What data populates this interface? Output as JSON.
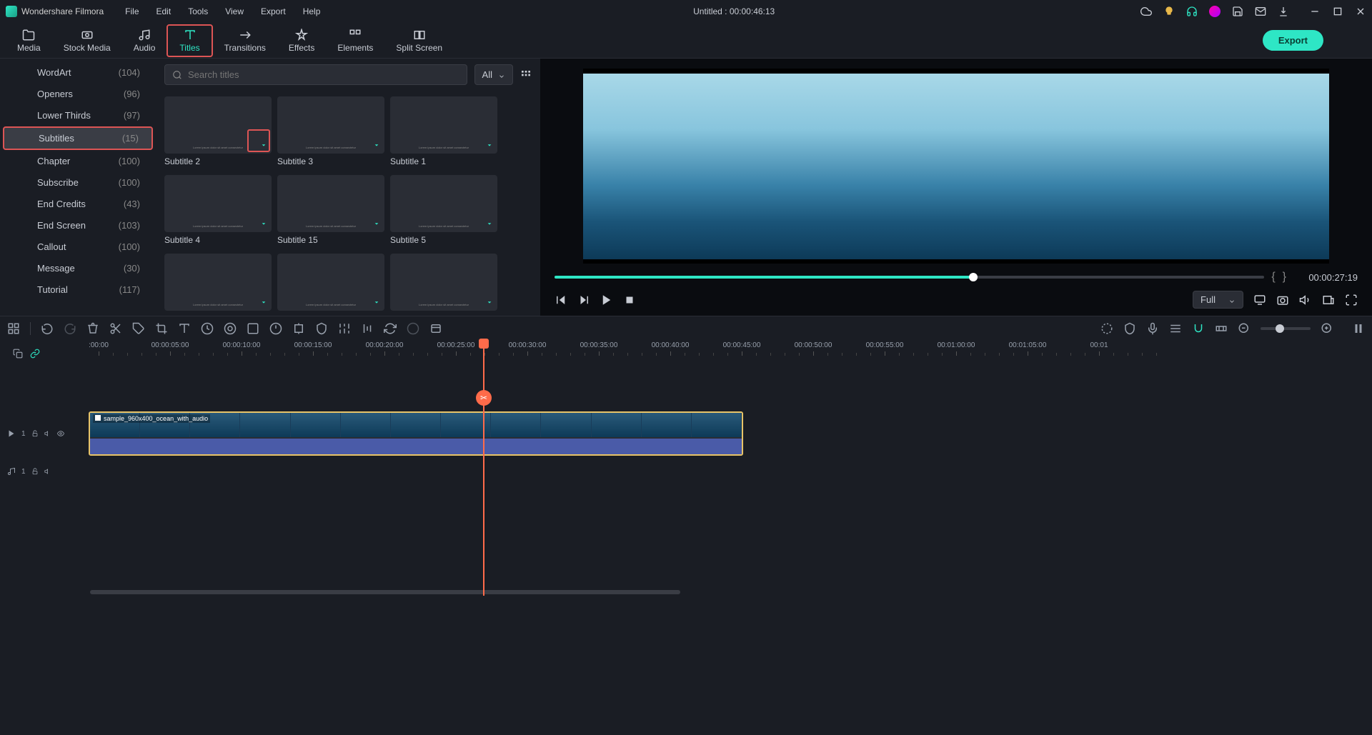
{
  "app": {
    "name": "Wondershare Filmora",
    "title_center": "Untitled : 00:00:46:13"
  },
  "menubar": [
    "File",
    "Edit",
    "Tools",
    "View",
    "Export",
    "Help"
  ],
  "toolbar_tabs": [
    {
      "id": "media",
      "label": "Media"
    },
    {
      "id": "stock-media",
      "label": "Stock Media"
    },
    {
      "id": "audio",
      "label": "Audio"
    },
    {
      "id": "titles",
      "label": "Titles"
    },
    {
      "id": "transitions",
      "label": "Transitions"
    },
    {
      "id": "effects",
      "label": "Effects"
    },
    {
      "id": "elements",
      "label": "Elements"
    },
    {
      "id": "split-screen",
      "label": "Split Screen"
    }
  ],
  "export_label": "Export",
  "sidebar": {
    "items": [
      {
        "label": "WordArt",
        "count": "(104)"
      },
      {
        "label": "Openers",
        "count": "(96)"
      },
      {
        "label": "Lower Thirds",
        "count": "(97)"
      },
      {
        "label": "Subtitles",
        "count": "(15)",
        "selected": true
      },
      {
        "label": "Chapter",
        "count": "(100)"
      },
      {
        "label": "Subscribe",
        "count": "(100)"
      },
      {
        "label": "End Credits",
        "count": "(43)"
      },
      {
        "label": "End Screen",
        "count": "(103)"
      },
      {
        "label": "Callout",
        "count": "(100)"
      },
      {
        "label": "Message",
        "count": "(30)"
      },
      {
        "label": "Tutorial",
        "count": "(117)"
      }
    ]
  },
  "search": {
    "placeholder": "Search titles",
    "filter": "All"
  },
  "thumbs": [
    {
      "label": "Subtitle 2",
      "highlight_dl": true
    },
    {
      "label": "Subtitle 3"
    },
    {
      "label": "Subtitle 1"
    },
    {
      "label": "Subtitle 4"
    },
    {
      "label": "Subtitle 15"
    },
    {
      "label": "Subtitle 5"
    },
    {
      "label": ""
    },
    {
      "label": ""
    },
    {
      "label": ""
    }
  ],
  "preview": {
    "time": "00:00:27:19",
    "resolution": "Full"
  },
  "ruler": [
    ":00:00",
    "00:00:05:00",
    "00:00:10:00",
    "00:00:15:00",
    "00:00:20:00",
    "00:00:25:00",
    "00:00:30:00",
    "00:00:35:00",
    "00:00:40:00",
    "00:00:45:00",
    "00:00:50:00",
    "00:00:55:00",
    "00:01:00:00",
    "00:01:05:00",
    "00:01"
  ],
  "clip": {
    "name": "sample_960x400_ocean_with_audio"
  },
  "track_labels": {
    "video": "1",
    "audio": "1"
  }
}
